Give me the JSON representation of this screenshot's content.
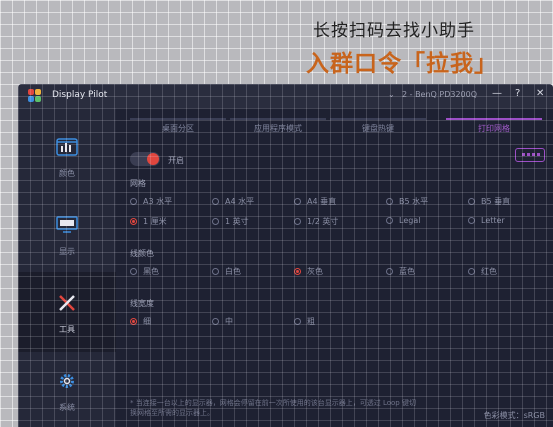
{
  "promo": {
    "line1": "长按扫码去找小助手",
    "line2": "入群口令「拉我」"
  },
  "window": {
    "app_title": "Display Pilot",
    "monitor": "2 - BenQ PD3200Q",
    "minimize": "—",
    "help": "?",
    "close": "✕"
  },
  "sidebar": {
    "items": [
      {
        "label": "颜色",
        "icon": "color-icon"
      },
      {
        "label": "显示",
        "icon": "display-icon"
      },
      {
        "label": "工具",
        "icon": "tools-icon"
      },
      {
        "label": "系统",
        "icon": "gear-icon"
      }
    ]
  },
  "tabs": [
    "桌面分区",
    "应用程序模式",
    "键盘热键",
    "打印网格"
  ],
  "toggle": {
    "label": "开启",
    "state": "on"
  },
  "sections": {
    "grid": {
      "title": "网格",
      "row1": [
        "A3 水平",
        "A4 水平",
        "A4 垂直",
        "B5 水平",
        "B5 垂直"
      ],
      "row2": [
        "1 厘米",
        "1 英寸",
        "1/2 英寸",
        "Legal",
        "Letter"
      ]
    },
    "line_color": {
      "title": "线颜色",
      "options": [
        "黑色",
        "白色",
        "灰色",
        "蓝色",
        "红色"
      ]
    },
    "line_width": {
      "title": "线宽度",
      "options": [
        "细",
        "中",
        "粗"
      ]
    }
  },
  "note": "* 当连接一台以上的显示器，网格会停留在前一次所使用的该台显示器上，可透过 Loop 键切换网格至所需的显示器上。",
  "color_space": "色彩模式：sRGB",
  "colors": {
    "accent": "#9c4fc6",
    "selected": "#e0463e",
    "promo_title": "#c8641c"
  }
}
